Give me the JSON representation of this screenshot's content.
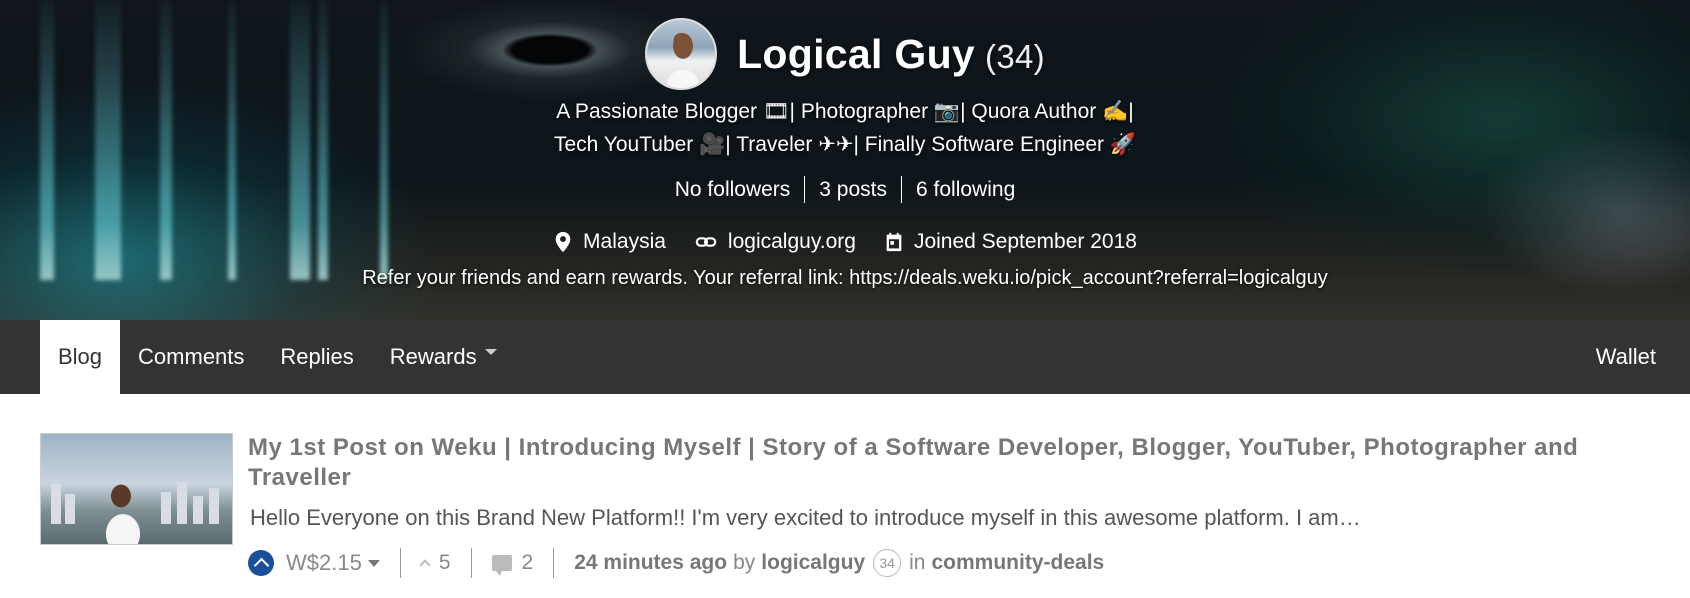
{
  "profile": {
    "name": "Logical Guy",
    "reputation": "(34)",
    "about_line1": "A Passionate Blogger 🎞| Photographer 📷| Quora Author ✍|",
    "about_line2": "Tech YouTuber 🎥| Traveler ✈✈| Finally Software Engineer 🚀",
    "followers": "No followers",
    "posts": "3 posts",
    "following": "6 following",
    "location": "Malaysia",
    "website": "logicalguy.org",
    "joined": "Joined September 2018",
    "referral": "Refer your friends and earn rewards. Your referral link: https://deals.weku.io/pick_account?referral=logicalguy",
    "icons": {
      "location": "location-pin-icon",
      "website": "link-icon",
      "joined": "calendar-icon"
    }
  },
  "nav": {
    "tabs": [
      {
        "label": "Blog",
        "active": true
      },
      {
        "label": "Comments",
        "active": false
      },
      {
        "label": "Replies",
        "active": false
      },
      {
        "label": "Rewards",
        "active": false,
        "dropdown": true
      }
    ],
    "wallet": "Wallet"
  },
  "post": {
    "title": "My 1st Post on Weku | Introducing Myself | Story of a Software Developer, Blogger, YouTuber, Photographer and Traveller",
    "excerpt": "Hello Everyone on this Brand New Platform!! I'm very excited to introduce myself in this awesome platform. I am…",
    "payout": "W$2.15",
    "votes": "5",
    "comments": "2",
    "time": "24 minutes ago",
    "by": "by",
    "author": "logicalguy",
    "author_rep": "34",
    "in": "in",
    "community": "community-deals"
  },
  "colors": {
    "nav_bg": "#333333",
    "upvote": "#1a5099",
    "muted_text": "#777777"
  }
}
